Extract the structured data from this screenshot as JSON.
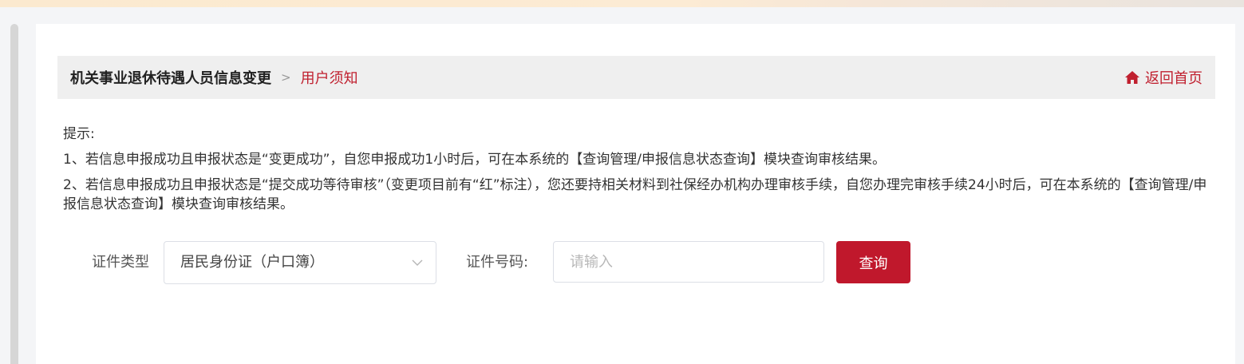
{
  "breadcrumb": {
    "root": "机关事业退休待遇人员信息变更",
    "separator": ">",
    "current": "用户须知"
  },
  "header": {
    "home_label": "返回首页",
    "home_icon": "home-icon"
  },
  "notice": {
    "title": "提示:",
    "items": [
      "1、若信息申报成功且申报状态是“变更成功”，自您申报成功1小时后，可在本系统的【查询管理/申报信息状态查询】模块查询审核结果。",
      "2、若信息申报成功且申报状态是“提交成功等待审核”（变更项目前有“红”标注），您还要持相关材料到社保经办机构办理审核手续，自您办理完审核手续24小时后，可在本系统的【查询管理/申报信息状态查询】模块查询审核结果。"
    ]
  },
  "form": {
    "id_type_label": "证件类型",
    "id_type_value": "居民身份证（户口簿）",
    "id_number_label": "证件号码:",
    "id_number_placeholder": "请输入",
    "id_number_value": "",
    "query_button": "查询"
  },
  "colors": {
    "accent": "#c0182c",
    "header_bg": "#efefef",
    "page_bg": "#f4f5f7"
  }
}
